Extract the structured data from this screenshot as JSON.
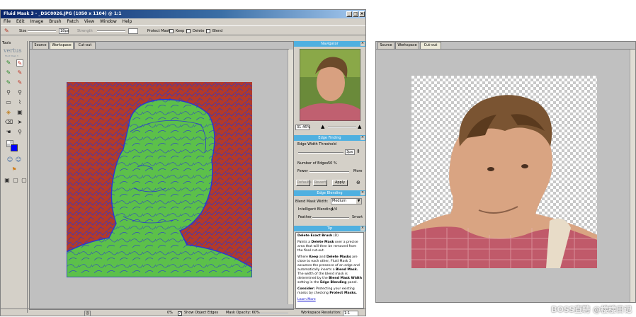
{
  "window": {
    "title": "Fluid Mask 3 - _DSC0026.JPG (1050 x 1104) @ 1:1",
    "menu": [
      "File",
      "Edit",
      "Image",
      "Brush",
      "Patch",
      "View",
      "Window",
      "Help"
    ]
  },
  "options_bar": {
    "size_label": "Size",
    "size_value": "18px",
    "strength_label": "Strength",
    "protect_mask_label": "Protect Mask:",
    "keep_label": "Keep",
    "delete_label": "Delete",
    "blend_label": "Blend"
  },
  "tools": {
    "header": "Tools",
    "logo": "vertus",
    "logo_sub": "Fluid Mask 3"
  },
  "tabs": [
    "Source",
    "Workspace",
    "Cut-out"
  ],
  "navigator": {
    "title": "Navigator",
    "zoom": "31.46%"
  },
  "edge_finding": {
    "title": "Edge Finding",
    "threshold_label": "Edge Width Threshold",
    "threshold_value": "3px",
    "edges_label": "Number of Edges:",
    "edges_value": "50 %",
    "fewer": "Fewer",
    "more": "More",
    "btn_defaults": "Defaults",
    "btn_revert": "Revert",
    "btn_apply": "Apply"
  },
  "edge_blending": {
    "title": "Edge Blending",
    "width_label": "Blend Mask Width:",
    "width_value": "Medium",
    "intelligent_label": "Intelligent Blending:",
    "intelligent_value": "1/4",
    "feather": "Feather",
    "smart": "Smart"
  },
  "tip": {
    "title": "Tip",
    "heading": "Delete Exact Brush",
    "heading_key": "(D)",
    "p1a": "Paints a",
    "p1b": "Delete Mask",
    "p1c": "over a precise area that will then be removed from the final cut-out.",
    "p2a": "Where",
    "p2b": "Keep",
    "p2c": "and",
    "p2d": "Delete Masks",
    "p2e": "are close to each other, Fluid Mask 3 assumes the presence of an edge and automatically inserts a",
    "p2f": "Blend Mask.",
    "p2g": "The width of the blend mask is determined by the",
    "p2h": "Blend Mask Width",
    "p2i": "setting in the",
    "p2j": "Edge Blending",
    "p2k": "panel.",
    "p3a": "Consider:",
    "p3b": "Protecting your existing masks by checking",
    "p3c": "Protect Masks.",
    "link": "Learn More"
  },
  "status": {
    "percent": "0%",
    "show_edges": "Show Object Edges",
    "mask_opacity": "Mask Opacity: 60%",
    "resolution_label": "Workspace Resolution:",
    "resolution_value": "1:1"
  },
  "right_window": {
    "tabs": [
      "Source",
      "Workspace",
      "Cut-out"
    ]
  },
  "watermark": "BOSS直聘 @楼楼日记",
  "colors": {
    "panel_head": "#4fb0e0",
    "mask_green": "#5cc04a",
    "mask_red": "#b23a2a",
    "edge_blue": "#2a3ad0"
  }
}
